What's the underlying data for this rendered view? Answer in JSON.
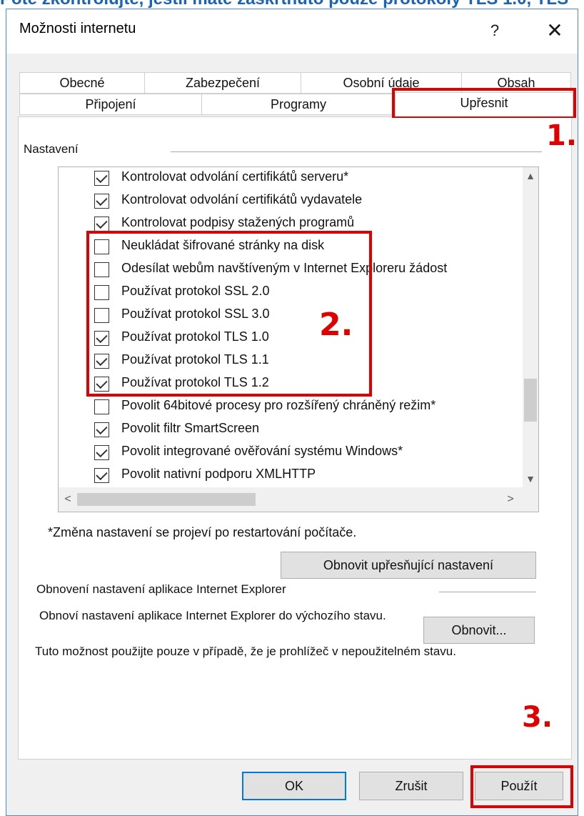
{
  "top_caption": "Poté zkontrolujte, jestli máte zaškrtnuto pouze protokoly TLS 1.0, TLS",
  "window": {
    "title": "Možnosti internetu",
    "help_glyph": "?",
    "close_glyph": "✕"
  },
  "tabs_row1": [
    "Obecné",
    "Zabezpečení",
    "Osobní údaje",
    "Obsah"
  ],
  "tabs_row2": [
    "Připojení",
    "Programy",
    "Upřesnit"
  ],
  "active_tab": "Upřesnit",
  "settings": {
    "group_label": "Nastavení",
    "items": [
      {
        "label": "Kontrolovat odvolání certifikátů serveru*",
        "checked": true
      },
      {
        "label": "Kontrolovat odvolání certifikátů vydavatele",
        "checked": true
      },
      {
        "label": "Kontrolovat podpisy stažených programů",
        "checked": true
      },
      {
        "label": "Neukládat šifrované stránky na disk",
        "checked": false
      },
      {
        "label": "Odesílat webům navštíveným v Internet Exploreru žádost",
        "checked": false
      },
      {
        "label": "Používat protokol SSL 2.0",
        "checked": false
      },
      {
        "label": "Používat protokol SSL 3.0",
        "checked": false
      },
      {
        "label": "Používat protokol TLS 1.0",
        "checked": true
      },
      {
        "label": "Používat protokol TLS 1.1",
        "checked": true
      },
      {
        "label": "Používat protokol TLS 1.2",
        "checked": true
      },
      {
        "label": "Povolit 64bitové procesy pro rozšířený chráněný režim*",
        "checked": false
      },
      {
        "label": "Povolit filtr SmartScreen",
        "checked": true
      },
      {
        "label": "Povolit integrované ověřování systému Windows*",
        "checked": true
      },
      {
        "label": "Povolit nativní podporu XMLHTTP",
        "checked": true
      }
    ],
    "restart_note": "*Změna nastavení se projeví po restartování počítače.",
    "restore_advanced_button": "Obnovit upřesňující nastavení"
  },
  "reset_section": {
    "label": "Obnovení nastavení aplikace Internet Explorer",
    "description": "Obnoví nastavení aplikace Internet Explorer do výchozího stavu.",
    "reset_button": "Obnovit...",
    "warning": "Tuto možnost použijte pouze v případě, že je prohlížeč v nepoužitelném stavu."
  },
  "footer": {
    "ok": "OK",
    "cancel": "Zrušit",
    "apply": "Použít"
  },
  "annotations": {
    "step1": "1.",
    "step2": "2.",
    "step3": "3.",
    "color": "#e00000"
  },
  "icons": {
    "scroll_up": "▲",
    "scroll_down": "▼",
    "scroll_left": "<",
    "scroll_right": ">"
  }
}
